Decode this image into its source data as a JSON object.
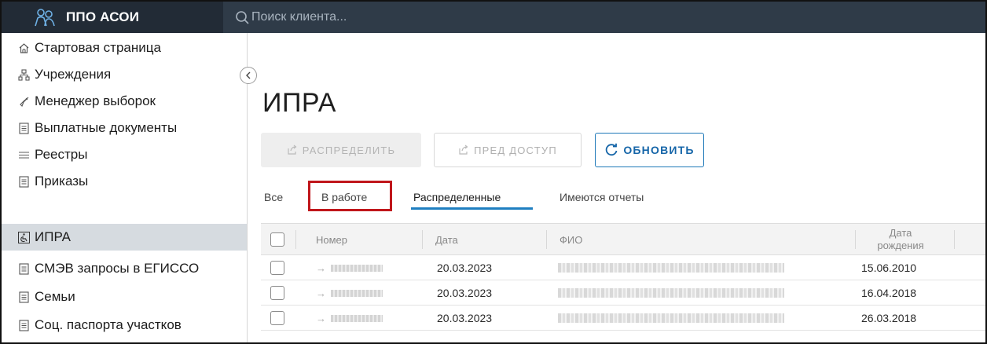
{
  "header": {
    "app_title": "ППО АСОИ",
    "brand_icon": "persons-icon",
    "search_placeholder": "Поиск клиента..."
  },
  "sidebar": {
    "items": [
      {
        "label": "Стартовая страница",
        "icon": "home-icon",
        "active": false
      },
      {
        "label": "Учреждения",
        "icon": "org-tree-icon",
        "active": false
      },
      {
        "label": "Менеджер выборок",
        "icon": "filter-icon",
        "active": false
      },
      {
        "label": "Выплатные документы",
        "icon": "document-icon",
        "active": false
      },
      {
        "label": "Реестры",
        "icon": "list-icon",
        "active": false
      },
      {
        "label": "Приказы",
        "icon": "document-icon",
        "active": false
      },
      {
        "label": "ИПРА",
        "icon": "accessibility-icon",
        "active": true
      },
      {
        "label": "СМЭВ запросы в ЕГИССО",
        "icon": "document-icon",
        "active": false
      },
      {
        "label": "Семьи",
        "icon": "document-icon",
        "active": false
      },
      {
        "label": "Соц. паспорта участков",
        "icon": "document-icon",
        "active": false
      }
    ]
  },
  "main": {
    "title": "ИПРА",
    "buttons": {
      "distribute": "РАСПРЕДЕЛИТЬ",
      "pre_access": "ПРЕД ДОСТУП",
      "refresh": "ОБНОВИТЬ"
    },
    "tabs": [
      {
        "label": "Все"
      },
      {
        "label": "В работе"
      },
      {
        "label": "Распределенные"
      },
      {
        "label": "Имеются отчеты"
      }
    ],
    "active_tab": "Распределенные",
    "highlighted_tab": "В работе"
  },
  "table": {
    "columns": {
      "number": "Номер",
      "date": "Дата",
      "fio": "ФИО",
      "dob_line1": "Дата",
      "dob_line2": "рождения"
    },
    "rows": [
      {
        "date": "20.03.2023",
        "dob": "15.06.2010"
      },
      {
        "date": "20.03.2023",
        "dob": "16.04.2018"
      },
      {
        "date": "20.03.2023",
        "dob": "26.03.2018"
      }
    ]
  },
  "colors": {
    "topbar": "#2f3b48",
    "brand_bg": "#222b36",
    "accent": "#1f7fc1",
    "highlight": "#c0161b",
    "active_sidebar": "#d6dbe0"
  }
}
